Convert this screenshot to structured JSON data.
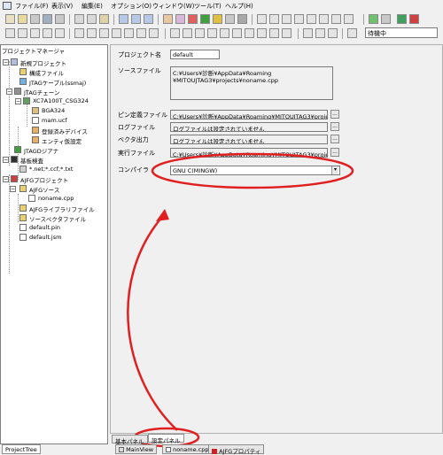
{
  "menu": [
    "ファイル(F)",
    "表示(V)",
    "編集(E)",
    "オプション(O)",
    "ウィンドウ(W)",
    "ツール(T)",
    "ヘルプ(H)"
  ],
  "toolbar": {
    "status_value": "待機中"
  },
  "left_panel": {
    "title": "プロジェクトマネージャ",
    "tree": {
      "new_project": "新規プロジェクト",
      "config_file": "構成ファイル",
      "jtag_cable": "JTAGケーブル(ssmaj)",
      "jtag_chain": "JTAGチェーン",
      "device": "XC7A100T_CSG324",
      "bga": "BGA324",
      "ucf": "mam.ucf",
      "registered": "登録済みデバイス",
      "enable_settings": "エンティ仮設定",
      "jtag_designer": "JTAGDジアナ",
      "board_check": "基板検査",
      "net_files": "*.net;*.ccf;*.txt",
      "ajfg_project": "AJFGプロジェクト",
      "ajfg_source": "AJFGソース",
      "noname_cpp": "noname.cpp",
      "ajfg_library": "AJFGライブラリファイル",
      "source_spec": "ソースペクタファイル",
      "default_pin": "default.pin",
      "default_jsm": "default.jsm"
    },
    "bottom_tab": "ProjectTree"
  },
  "right_panel": {
    "project_name_label": "プロジェクト名",
    "project_name_value": "default",
    "source_file_label": "ソースファイル",
    "source_file_line1": "C:¥Users¥診断¥AppData¥Roaming",
    "source_file_line2": "¥MITOUJTAG3¥projects¥noname.cpp",
    "pin_def_label": "ピン定義ファイル",
    "pin_def_value": "C:¥Users¥診断¥AppData¥Roaming¥MITOUJTAG3¥proje",
    "log_label": "ログファイル",
    "log_value": "ログファイルは設定されていません",
    "vector_label": "ベクタ出力",
    "vector_value": "ログファイルは設定されていません",
    "exec_label": "実行ファイル",
    "exec_value": "C:¥Users¥診断¥AppData¥Roaming¥MITOUJTAG3¥proje",
    "compiler_label": "コンパイラ",
    "compiler_value": "GNU C(MINGW)",
    "browse_label": "..."
  },
  "panel_tabs": [
    "基本パネル",
    "設定パネル"
  ],
  "doc_tabs": [
    "MainView",
    "noname.cpp",
    "AJFGプロパティ"
  ]
}
